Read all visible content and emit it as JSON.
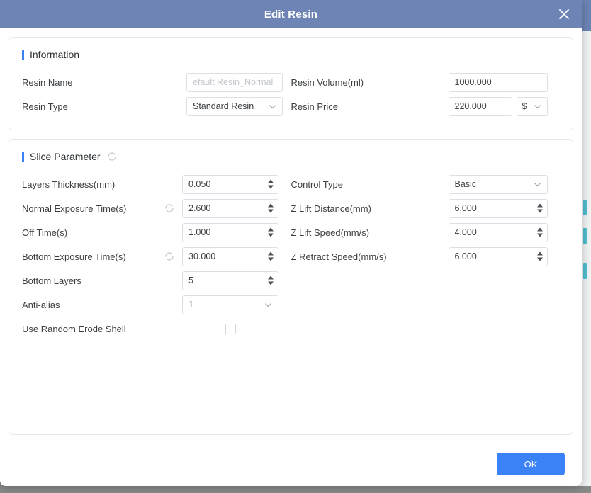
{
  "window": {
    "title": "Edit Resin",
    "close_icon": "close-icon"
  },
  "information": {
    "heading": "Information",
    "fields": {
      "resin_name_label": "Resin Name",
      "resin_name_placeholder": "efault Resin_Normal",
      "resin_name_value": "",
      "resin_volume_label": "Resin Volume(ml)",
      "resin_volume_value": "1000.000",
      "resin_type_label": "Resin Type",
      "resin_type_value": "Standard Resin",
      "resin_price_label": "Resin Price",
      "resin_price_value": "220.000",
      "currency_value": "$"
    }
  },
  "slice_parameter": {
    "heading": "Slice Parameter",
    "reset_icon": "reset-icon",
    "left": [
      {
        "label": "Layers Thickness(mm)",
        "value": "0.050",
        "type": "number",
        "reset": false
      },
      {
        "label": "Normal Exposure Time(s)",
        "value": "2.600",
        "type": "number",
        "reset": true
      },
      {
        "label": "Off Time(s)",
        "value": "1.000",
        "type": "number",
        "reset": false
      },
      {
        "label": "Bottom Exposure Time(s)",
        "value": "30.000",
        "type": "number",
        "reset": true
      },
      {
        "label": "Bottom Layers",
        "value": "5",
        "type": "number",
        "reset": false
      },
      {
        "label": "Anti-alias",
        "value": "1",
        "type": "select",
        "reset": false
      },
      {
        "label": "Use Random Erode Shell",
        "value": "",
        "type": "checkbox",
        "checked": false,
        "reset": false
      }
    ],
    "right": [
      {
        "label": "Control Type",
        "value": "Basic",
        "type": "select"
      },
      {
        "label": "Z Lift Distance(mm)",
        "value": "6.000",
        "type": "number"
      },
      {
        "label": "Z Lift Speed(mm/s)",
        "value": "4.000",
        "type": "number"
      },
      {
        "label": "Z Retract Speed(mm/s)",
        "value": "6.000",
        "type": "number"
      }
    ]
  },
  "footer": {
    "ok_label": "OK"
  },
  "colors": {
    "titlebar": "#6d84b4",
    "accent": "#3b82f6",
    "primary_button": "#3b82f6",
    "backdrop": "#8a8a8a",
    "bg_accent": "#35b5c9"
  }
}
